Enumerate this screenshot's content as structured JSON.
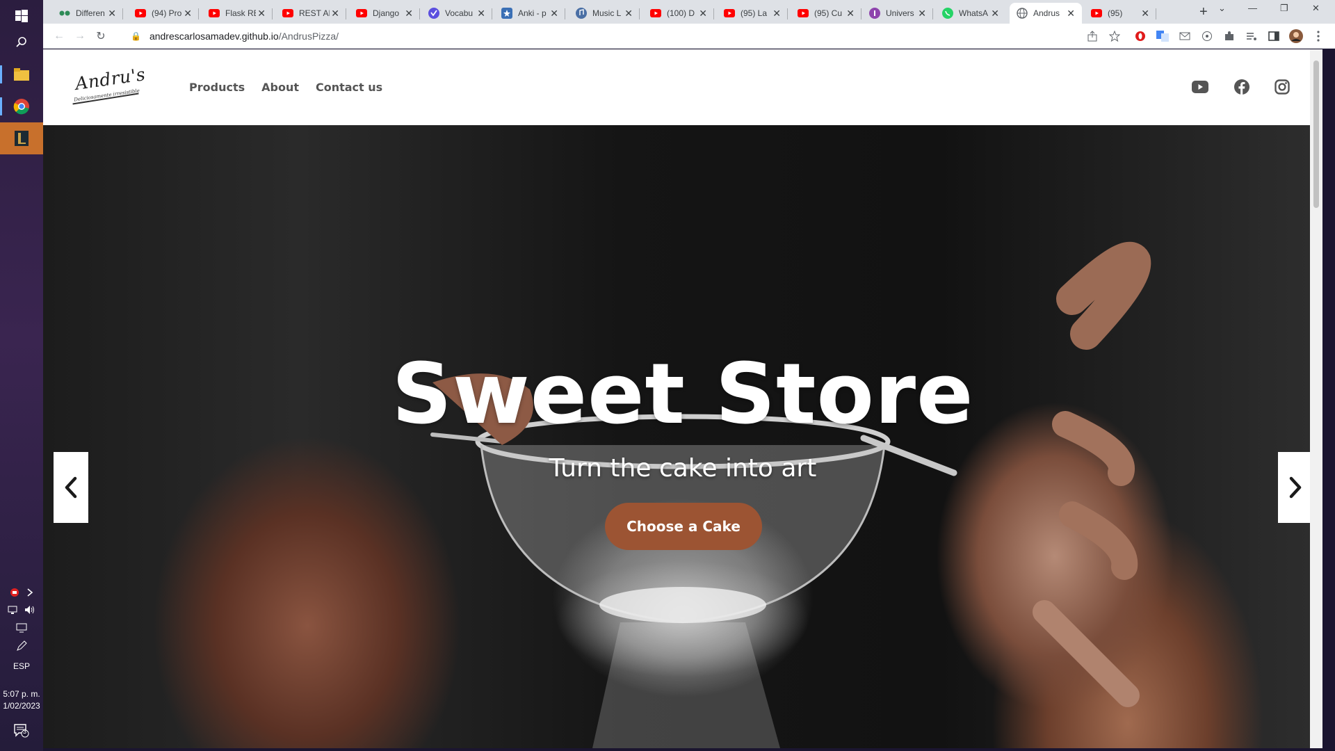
{
  "taskbar": {
    "language": "ESP",
    "time": "5:07 p. m.",
    "date": "1/02/2023",
    "notification_count": "3",
    "icons": [
      "windows-start-icon",
      "search-icon",
      "file-explorer-icon",
      "chrome-icon",
      "league-of-legends-icon"
    ]
  },
  "browser": {
    "tabs": [
      {
        "title": "Differen",
        "icon": "diff-icon"
      },
      {
        "title": "(94) Pro",
        "icon": "youtube-icon"
      },
      {
        "title": "Flask RE",
        "icon": "youtube-icon"
      },
      {
        "title": "REST AP",
        "icon": "youtube-icon"
      },
      {
        "title": "Django",
        "icon": "youtube-icon"
      },
      {
        "title": "Vocabu",
        "icon": "vocabulary-icon"
      },
      {
        "title": "Anki - p",
        "icon": "anki-icon"
      },
      {
        "title": "Music L",
        "icon": "music-icon"
      },
      {
        "title": "(100) D",
        "icon": "youtube-icon"
      },
      {
        "title": "(95) La",
        "icon": "youtube-icon"
      },
      {
        "title": "(95) Cu",
        "icon": "youtube-icon"
      },
      {
        "title": "Univers",
        "icon": "universe-icon"
      },
      {
        "title": "WhatsA",
        "icon": "whatsapp-icon"
      },
      {
        "title": "Andrus",
        "icon": "globe-icon"
      },
      {
        "title": "(95)",
        "icon": "youtube-icon"
      }
    ],
    "active_tab": 13,
    "url_host": "andrescarlosamadev.github.io",
    "url_path": "/AndrusPizza/"
  },
  "site": {
    "logo_text": "Andru's",
    "logo_tagline": "Deliciosamente irresistible",
    "nav": [
      "Products",
      "About",
      "Contact us"
    ],
    "social": [
      "youtube-icon",
      "facebook-icon",
      "instagram-icon"
    ]
  },
  "hero": {
    "title": "Sweet Store",
    "subtitle": "Turn the cake into art",
    "cta": "Choose a Cake"
  },
  "colors": {
    "cta": "#9c5433",
    "taskbar_active": "#c8702c"
  }
}
